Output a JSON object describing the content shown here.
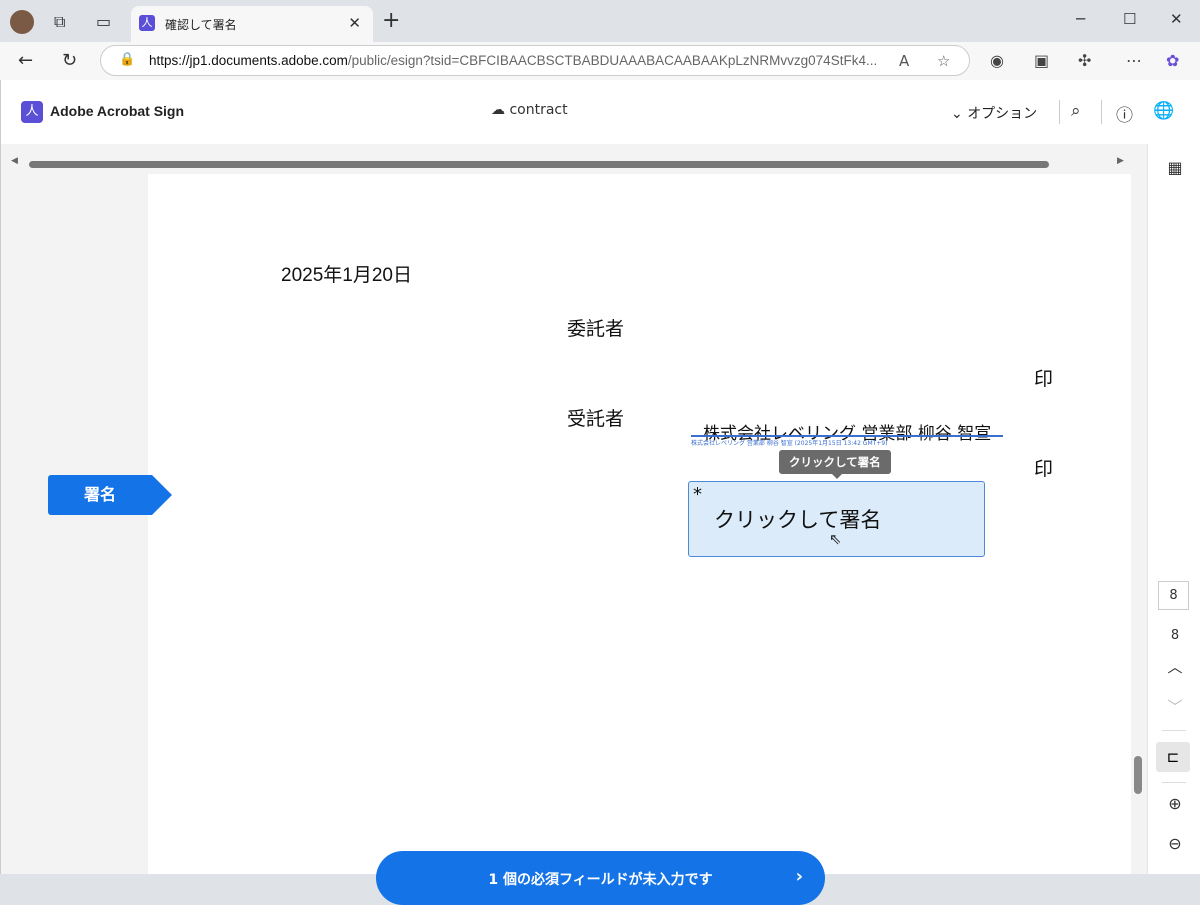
{
  "browser": {
    "tab_title": "確認して署名",
    "url_host": "https://jp1.documents.adobe.com",
    "url_path": "/public/esign?tsid=CBFCIBAACBSCTBABDUAAABACAABAAKpLzNRMvvzg074StFk4..."
  },
  "app": {
    "brand": "Adobe Acrobat Sign",
    "document_name": "contract",
    "options_label": "オプション"
  },
  "document": {
    "date": "2025年1月20日",
    "consignor_label": "委託者",
    "consignor_signature": "株式会社レベリング 営業部 柳谷 智宣",
    "consignor_signature_meta": "株式会社レベリング 営業部 柳谷 智宣 (2025年1月15日 13:42 GMT+9)",
    "seal1": "印",
    "consignee_label": "受託者",
    "tooltip": "クリックして署名",
    "sign_field_required": "*",
    "sign_field_label": "クリックして署名",
    "seal2": "印"
  },
  "sign_tag": "署名",
  "cta": {
    "label": "1 個の必須フィールドが未入力です"
  },
  "rail": {
    "page_input": "8",
    "total_pages": "8"
  },
  "colors": {
    "accent": "#1473e6",
    "field_bg": "#dcebfa",
    "brand": "#5a4fd6"
  }
}
